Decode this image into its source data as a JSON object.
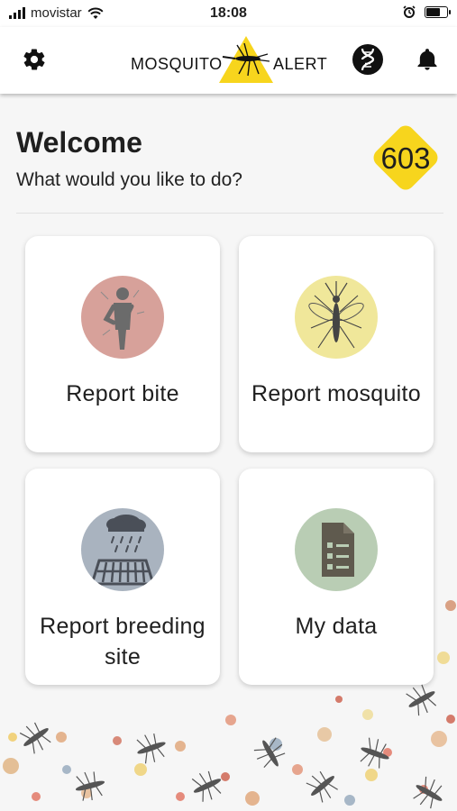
{
  "status_bar": {
    "carrier": "movistar",
    "time": "18:08",
    "icons": [
      "signal-icon",
      "wifi-icon",
      "alarm-icon",
      "battery-icon"
    ]
  },
  "app_bar": {
    "logo_left": "MOSQUITO",
    "logo_right": "ALERT",
    "icons": [
      "settings-gear-icon",
      "dna-icon",
      "notifications-bell-icon"
    ]
  },
  "welcome": {
    "title": "Welcome",
    "subtitle": "What would you like to do?",
    "score": "603"
  },
  "actions": [
    {
      "label": "Report bite",
      "icon": "bite-person-icon",
      "color": "#d7a19a"
    },
    {
      "label": "Report mosquito",
      "icon": "mosquito-icon",
      "color": "#f0e79a"
    },
    {
      "label": "Report breeding site",
      "icon": "breeding-site-rain-drain-icon",
      "color": "#a9b3bf"
    },
    {
      "label": "My data",
      "icon": "document-list-icon",
      "color": "#b9cdb4"
    }
  ],
  "colors": {
    "brand_yellow": "#f7d51d",
    "background": "#f6f6f6",
    "card": "#ffffff",
    "text": "#1f1f1f"
  }
}
